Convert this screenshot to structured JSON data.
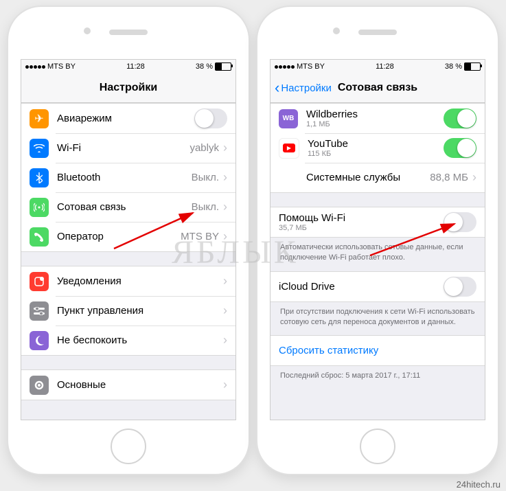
{
  "common": {
    "carrier": "MTS BY",
    "time": "11:28",
    "battery": "38 %"
  },
  "leftPhone": {
    "navTitle": "Настройки",
    "rows": {
      "airplane": "Авиарежим",
      "wifi": "Wi-Fi",
      "wifiValue": "yablyk",
      "bt": "Bluetooth",
      "btValue": "Выкл.",
      "cell": "Сотовая связь",
      "cellValue": "Выкл.",
      "carrier": "Оператор",
      "carrierValue": "MTS BY",
      "notif": "Уведомления",
      "cc": "Пункт управления",
      "dnd": "Не беспокоить",
      "general": "Основные"
    }
  },
  "rightPhone": {
    "backLabel": "Настройки",
    "navTitle": "Сотовая связь",
    "apps": {
      "wb": "Wildberries",
      "wbSize": "1,1 МБ",
      "wbIconText": "WB",
      "yt": "YouTube",
      "ytSize": "115 КБ",
      "ytIcon": "▶",
      "sys": "Системные службы",
      "sysSize": "88,8 МБ"
    },
    "wifiAssist": {
      "title": "Помощь Wi-Fi",
      "size": "35,7 МБ",
      "footer": "Автоматически использовать сотовые данные, если подключение Wi-Fi работает плохо."
    },
    "icloud": {
      "title": "iCloud Drive",
      "footer": "При отсутствии подключения к сети Wi-Fi использовать сотовую сеть для переноса документов и данных."
    },
    "reset": "Сбросить статистику",
    "lastReset": "Последний сброс: 5 марта 2017 г., 17:11"
  },
  "watermark": "ЯБЛЫК",
  "credit": "24hitech.ru"
}
